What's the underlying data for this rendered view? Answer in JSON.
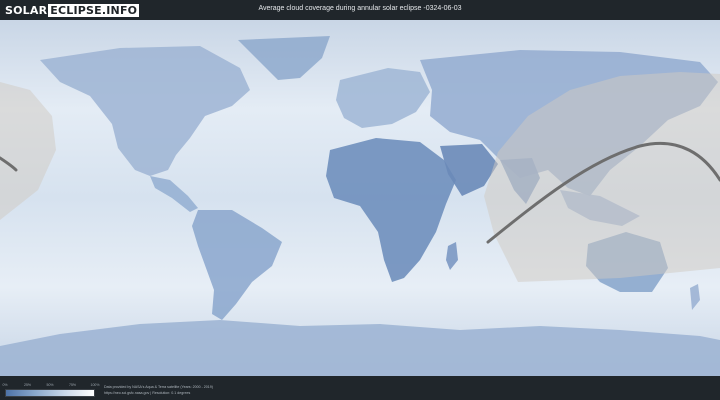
{
  "header": {
    "logo_solar": "SOLAR",
    "logo_rest": "ECLIPSE.INFO",
    "title": "Average cloud coverage during annular solar eclipse -0324-06-03"
  },
  "legend": {
    "ticks": [
      "0%",
      "25%",
      "50%",
      "75%",
      "100%"
    ],
    "colors": [
      "#4e73a8",
      "#8aa9cd",
      "#c9d8ea",
      "#ffffff"
    ]
  },
  "credits": {
    "line1": "Data provided by NASA's Aqua & Terra satellite (Years: 2000 - 2019)",
    "line2": "https://neo.sci.gsfc.nasa.gov | Resolution: 0.1 degrees"
  },
  "map": {
    "ocean_color": "#dbe6f2",
    "land_color": "#7f9cc4",
    "visibility_zone_color": "#cfcac2",
    "eclipse_path_color": "#6e6e6e"
  }
}
